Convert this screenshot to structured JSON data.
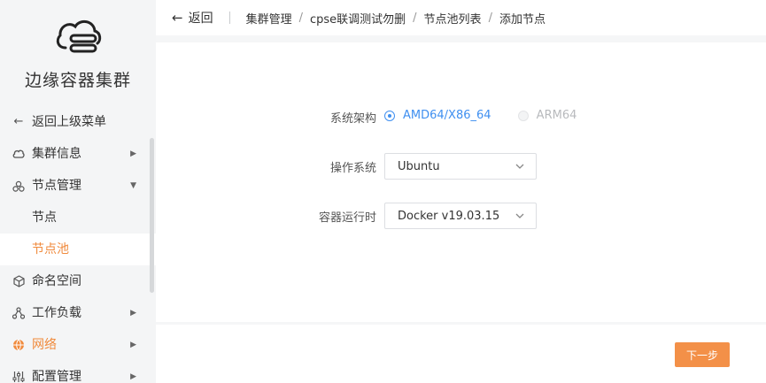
{
  "sidebar": {
    "app_title": "边缘容器集群",
    "back_menu": "返回上级菜单",
    "items": [
      {
        "label": "集群信息",
        "icon": "cloud-icon"
      },
      {
        "label": "节点管理",
        "icon": "nodes-icon"
      },
      {
        "label": "节点"
      },
      {
        "label": "节点池"
      },
      {
        "label": "命名空间",
        "icon": "cube-icon"
      },
      {
        "label": "工作负载",
        "icon": "workload-icon"
      },
      {
        "label": "网络",
        "icon": "globe-icon"
      },
      {
        "label": "配置管理",
        "icon": "sliders-icon"
      }
    ]
  },
  "header": {
    "back_label": "返回",
    "breadcrumb": [
      "集群管理",
      "cpse联调测试勿删",
      "节点池列表",
      "添加节点"
    ]
  },
  "form": {
    "arch_label": "系统架构",
    "arch_options": [
      "AMD64/X86_64",
      "ARM64"
    ],
    "arch_selected": "AMD64/X86_64",
    "os_label": "操作系统",
    "os_value": "Ubuntu",
    "runtime_label": "容器运行时",
    "runtime_value": "Docker v19.03.15"
  },
  "footer": {
    "next_label": "下一步"
  },
  "colors": {
    "accent": "#f08a3c",
    "primary_blue": "#3f8ff0",
    "button": "#f39048"
  }
}
